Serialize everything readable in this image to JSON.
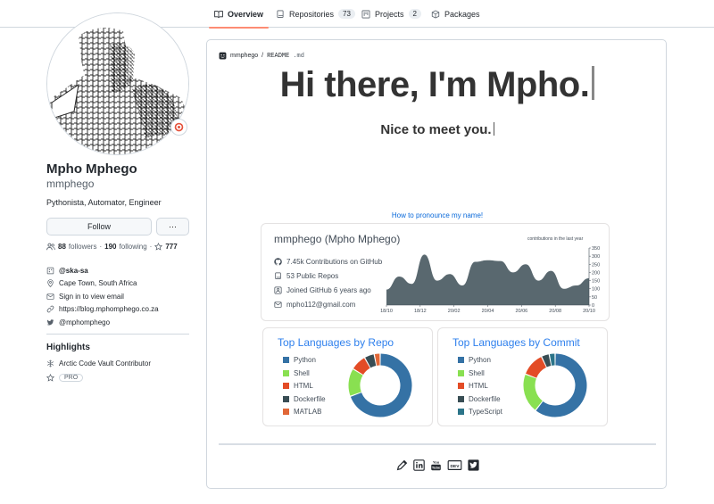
{
  "nav": {
    "tabs": [
      {
        "label": "Overview",
        "icon": "book-icon"
      },
      {
        "label": "Repositories",
        "icon": "repo-icon",
        "count": "73"
      },
      {
        "label": "Projects",
        "icon": "project-icon",
        "count": "2"
      },
      {
        "label": "Packages",
        "icon": "package-icon"
      }
    ],
    "active_color": "#fd8c73"
  },
  "profile": {
    "fullname": "Mpho Mphego",
    "login": "mmphego",
    "bio": "Pythonista, Automator, Engineer",
    "follow_label": "Follow",
    "more_label": "···",
    "followers_count": "88",
    "followers_label": "followers",
    "dot": "·",
    "following_count": "190",
    "following_label": "following",
    "stars_count": "777",
    "details": [
      {
        "icon": "organization-icon",
        "text": "@ska-sa",
        "bold": true
      },
      {
        "icon": "location-icon",
        "text": "Cape Town, South Africa"
      },
      {
        "icon": "mail-icon",
        "text": "Sign in to view email"
      },
      {
        "icon": "link-icon",
        "text": "https://blog.mphomphego.co.za"
      },
      {
        "icon": "twitter-icon",
        "text": "@mphomphego"
      }
    ],
    "highlights_title": "Highlights",
    "highlight_vault": "Arctic Code Vault Contributor",
    "highlight_pro": "PRO"
  },
  "readme": {
    "owner": "mmphego",
    "slash": " / ",
    "file": "README",
    "ext": ".md",
    "headline": "Hi there, I'm Mpho.",
    "subline": "Nice to meet you.",
    "pronounce_link": "How to pronounce my name!"
  },
  "stats_card": {
    "title": "mmphego (Mpho Mphego)",
    "lines": [
      {
        "icon": "github-icon",
        "text": "7.45k Contributions on GitHub"
      },
      {
        "icon": "repo-icon",
        "text": "53 Public Repos"
      },
      {
        "icon": "person-icon",
        "text": "Joined GitHub 6 years ago"
      },
      {
        "icon": "mail-icon",
        "text": "mpho112@gmail.com"
      }
    ],
    "chart_caption": "contributions in the last year"
  },
  "lang_repo": {
    "title": "Top Languages by Repo",
    "items": [
      {
        "name": "Python",
        "color": "#3572A5"
      },
      {
        "name": "Shell",
        "color": "#89e051"
      },
      {
        "name": "HTML",
        "color": "#e34c26"
      },
      {
        "name": "Dockerfile",
        "color": "#384d54"
      },
      {
        "name": "MATLAB",
        "color": "#e16737"
      }
    ]
  },
  "lang_commit": {
    "title": "Top Languages by Commit",
    "items": [
      {
        "name": "Python",
        "color": "#3572A5"
      },
      {
        "name": "Shell",
        "color": "#89e051"
      },
      {
        "name": "HTML",
        "color": "#e34c26"
      },
      {
        "name": "Dockerfile",
        "color": "#384d54"
      },
      {
        "name": "TypeScript",
        "color": "#2b7489"
      }
    ]
  },
  "socials": [
    "blog-icon",
    "linkedin-icon",
    "youtube-icon",
    "dev-icon",
    "twitter-icon"
  ],
  "chart_data": [
    {
      "type": "area",
      "caption": "contributions in the last year",
      "x": [
        "18/10",
        "18/12",
        "20/02",
        "20/04",
        "20/06",
        "20/08",
        "20/10"
      ],
      "ylim": [
        0,
        350
      ],
      "yticks": [
        "0",
        "50",
        "100",
        "150",
        "200",
        "250",
        "300",
        "350"
      ],
      "series": [
        {
          "values": [
            95,
            175,
            130,
            310,
            150,
            190,
            120,
            265,
            275,
            270,
            200,
            250,
            150,
            210,
            100,
            120,
            165
          ]
        }
      ],
      "fill": "#59686f"
    },
    {
      "type": "pie",
      "title": "Top Languages by Repo",
      "categories": [
        "Python",
        "Shell",
        "HTML",
        "Dockerfile",
        "MATLAB"
      ],
      "values": [
        68,
        14,
        8,
        5,
        3
      ],
      "colors": [
        "#3572A5",
        "#89e051",
        "#e34c26",
        "#384d54",
        "#e16737"
      ]
    },
    {
      "type": "pie",
      "title": "Top Languages by Commit",
      "categories": [
        "Python",
        "Shell",
        "HTML",
        "Dockerfile",
        "TypeScript"
      ],
      "values": [
        60,
        20,
        12,
        4,
        3
      ],
      "colors": [
        "#3572A5",
        "#89e051",
        "#e34c26",
        "#384d54",
        "#2b7489"
      ]
    }
  ]
}
